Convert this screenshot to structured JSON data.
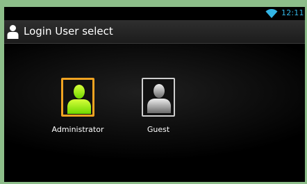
{
  "status_bar": {
    "time": "12:11",
    "wifi_icon": "wifi-icon",
    "accent_color": "#33b5e5"
  },
  "action_bar": {
    "title": "Login User select",
    "icon": "user-icon"
  },
  "users": [
    {
      "label": "Administrator",
      "icon": "user-icon",
      "selected": true,
      "highlight_color": "#f0a321"
    },
    {
      "label": "Guest",
      "icon": "user-icon",
      "selected": false
    }
  ]
}
